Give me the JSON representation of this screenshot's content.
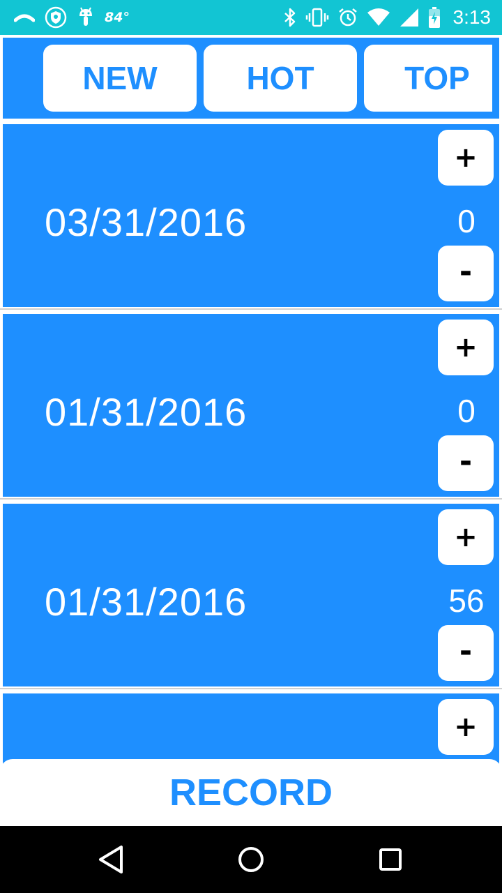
{
  "status_bar": {
    "temperature": "84°",
    "time": "3:13",
    "left_icons": [
      "cast-icon",
      "shield-icon",
      "android-icon"
    ],
    "right_icons": [
      "bluetooth-icon",
      "vibrate-icon",
      "alarm-icon",
      "wifi-icon",
      "signal-icon",
      "battery-charging-icon"
    ]
  },
  "tabs": [
    {
      "label": "NEW"
    },
    {
      "label": "HOT"
    },
    {
      "label": "TOP"
    }
  ],
  "rows": [
    {
      "date": "03/31/2016",
      "count": "0",
      "plus_label": "+",
      "minus_label": "-"
    },
    {
      "date": "01/31/2016",
      "count": "0",
      "plus_label": "+",
      "minus_label": "-"
    },
    {
      "date": "01/31/2016",
      "count": "56",
      "plus_label": "+",
      "minus_label": "-"
    },
    {
      "date": "",
      "count": "",
      "plus_label": "+",
      "minus_label": ""
    }
  ],
  "record_button": {
    "label": "RECORD"
  },
  "nav_bar": {
    "icons": [
      "back-icon",
      "home-icon",
      "recents-icon"
    ]
  },
  "colors": {
    "status_bar": "#12c5d3",
    "accent": "#1e8fff",
    "button_bg": "#ffffff",
    "nav_bar": "#000000"
  }
}
